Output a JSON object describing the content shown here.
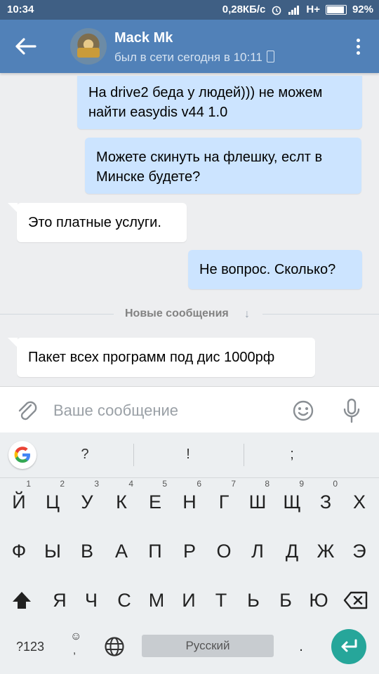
{
  "status_bar": {
    "time": "10:34",
    "speed": "0,28КБ/с",
    "network": "H+",
    "battery": "92%"
  },
  "header": {
    "contact_name": "Mack Mk",
    "presence": "был в сети сегодня в 10:11"
  },
  "messages": [
    {
      "direction": "out",
      "text": "На drive2 беда у людей))) не можем найти easydis v44 1.0"
    },
    {
      "direction": "out",
      "text": "Можете скинуть на флешку, еслт в Минске будете?"
    },
    {
      "direction": "in",
      "text": "Это платные услуги."
    },
    {
      "direction": "out",
      "text": "Не вопрос. Сколько?"
    },
    {
      "direction": "in",
      "text": "Пакет всех программ под дис 1000рф"
    }
  ],
  "new_messages_label": "Новые сообщения",
  "composer": {
    "placeholder": "Ваше сообщение",
    "value": ""
  },
  "keyboard": {
    "suggestions": [
      "?",
      "!",
      ";"
    ],
    "row1": [
      {
        "key": "Й",
        "hint": "1"
      },
      {
        "key": "Ц",
        "hint": "2"
      },
      {
        "key": "У",
        "hint": "3"
      },
      {
        "key": "К",
        "hint": "4"
      },
      {
        "key": "Е",
        "hint": "5"
      },
      {
        "key": "Н",
        "hint": "6"
      },
      {
        "key": "Г",
        "hint": "7"
      },
      {
        "key": "Ш",
        "hint": "8"
      },
      {
        "key": "Щ",
        "hint": "9"
      },
      {
        "key": "З",
        "hint": "0"
      },
      {
        "key": "Х",
        "hint": ""
      }
    ],
    "row2": [
      "Ф",
      "Ы",
      "В",
      "А",
      "П",
      "Р",
      "О",
      "Л",
      "Д",
      "Ж",
      "Э"
    ],
    "row3": [
      "Я",
      "Ч",
      "С",
      "М",
      "И",
      "Т",
      "Ь",
      "Б",
      "Ю"
    ],
    "symbols_label": "?123",
    "space_label": "Русский",
    "period": "."
  },
  "colors": {
    "header": "#5181b8",
    "status_bar": "#3f5f84",
    "outgoing_bubble": "#cce4ff",
    "incoming_bubble": "#ffffff",
    "enter_key": "#26a69a"
  },
  "icons": [
    "back-arrow-icon",
    "phone-icon",
    "more-vert-icon",
    "paperclip-icon",
    "smile-icon",
    "microphone-icon",
    "google-icon",
    "shift-icon",
    "backspace-icon",
    "emoji-icon",
    "globe-icon",
    "enter-icon"
  ]
}
